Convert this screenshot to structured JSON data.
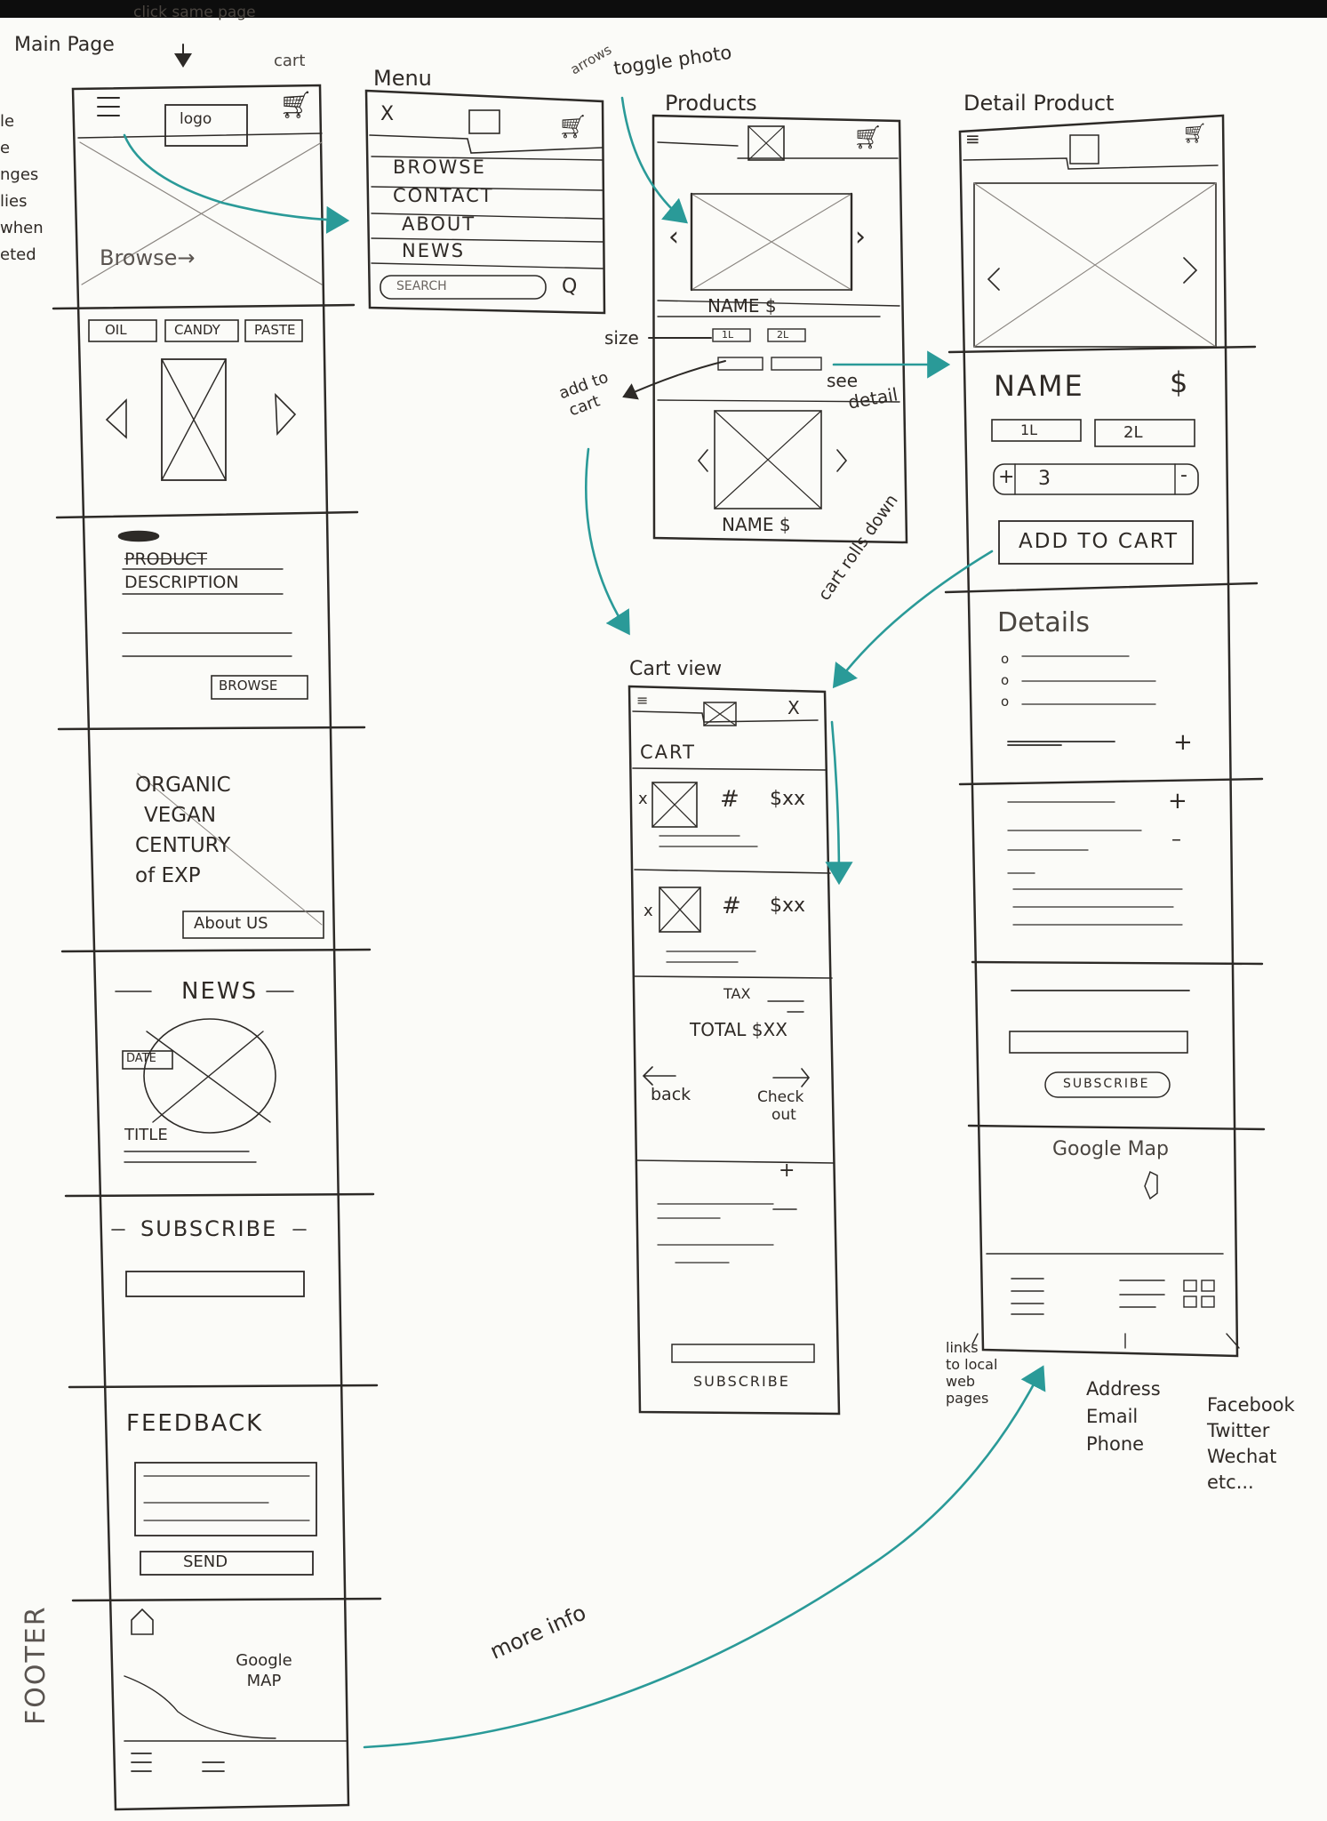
{
  "notes": {
    "main_page": "Main Page",
    "click_same_page": "click same page",
    "cart": "cart",
    "side_note": [
      "le",
      "e",
      "nges",
      "lies",
      "when",
      "eted"
    ],
    "arrows": "arrows",
    "toggle_photo": "toggle photo",
    "size": "size",
    "add_to_cart": [
      "add to",
      "cart"
    ],
    "see_detail": [
      "see",
      "detail"
    ],
    "cart_rolls_down": "cart rolls down",
    "more_info": "more info",
    "footer_vertical": "FOOTER",
    "links_note": [
      "links",
      "to local",
      "web",
      "pages"
    ],
    "contact_note": [
      "Address",
      "Email",
      "Phone"
    ],
    "social_note": [
      "Facebook",
      "Twitter",
      "Wechat",
      "etc..."
    ]
  },
  "main_page": {
    "logo": "logo",
    "hero_link": "Browse→",
    "tabs": [
      "OIL",
      "CANDY",
      "PASTE"
    ],
    "product_description": [
      "PRODUCT",
      "DESCRIPTION"
    ],
    "browse_button": "BROWSE",
    "about_text": [
      "ORGANIC",
      "VEGAN",
      "CENTURY",
      "of EXP"
    ],
    "about_button": "About US",
    "news_heading": "NEWS",
    "news_date": "DATE",
    "news_title": "TITLE",
    "subscribe_heading": "SUBSCRIBE",
    "feedback_heading": "FEEDBACK",
    "send_button": "SEND",
    "footer_map": "Google MAP"
  },
  "menu": {
    "title": "Menu",
    "close": "X",
    "items": [
      "BROWSE",
      "CONTACT",
      "ABOUT",
      "NEWS"
    ],
    "search": "SEARCH",
    "search_icon": "Q"
  },
  "products": {
    "title": "Products",
    "name_price": "NAME $",
    "sizes": [
      "1L",
      "2L"
    ],
    "name_bottom": "NAME $"
  },
  "cart_view": {
    "title": "Cart view",
    "close": "X",
    "heading": "CART",
    "items": [
      {
        "remove": "x",
        "qty": "#",
        "price": "$xx"
      },
      {
        "remove": "x",
        "qty": "#",
        "price": "$xx"
      }
    ],
    "tax": "TAX",
    "total": "TOTAL $XX",
    "back": "back",
    "checkout": [
      "Check",
      "out"
    ],
    "subscribe": "SUBSCRIBE"
  },
  "detail_product": {
    "title": "Detail Product",
    "name": "NAME",
    "price": "$",
    "sizes": [
      "1L",
      "2L"
    ],
    "qty": "3",
    "plus": "+",
    "minus": "-",
    "add_to_cart": "ADD TO CART",
    "details": "Details",
    "subscribe": "SUBSCRIBE",
    "map": "Google Map"
  },
  "colors": {
    "ink": "#2d2a27",
    "pencil": "#6b6560",
    "teal_arrow": "#2a9a98",
    "paper": "#fbfbf8"
  }
}
